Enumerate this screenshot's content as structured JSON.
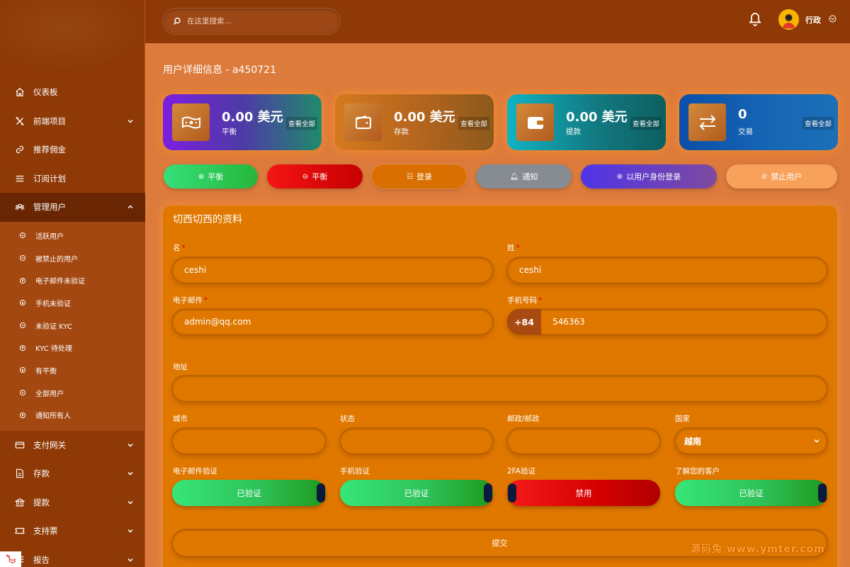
{
  "search": {
    "placeholder": "在这里搜索..."
  },
  "user": {
    "name": "行政"
  },
  "sidebar": {
    "items": [
      {
        "label": "仪表板"
      },
      {
        "label": "前端项目"
      },
      {
        "label": "推荐佣金"
      },
      {
        "label": "订阅计划"
      },
      {
        "label": "管理用户"
      },
      {
        "label": "支付网关"
      },
      {
        "label": "存款"
      },
      {
        "label": "提款"
      },
      {
        "label": "支持票"
      },
      {
        "label": "报告"
      }
    ],
    "subitems": [
      {
        "label": "活跃用户"
      },
      {
        "label": "被禁止的用户"
      },
      {
        "label": "电子邮件未验证"
      },
      {
        "label": "手机未验证"
      },
      {
        "label": "未验证 KYC"
      },
      {
        "label": "KYC 待处理"
      },
      {
        "label": "有平衡"
      },
      {
        "label": "全部用户"
      },
      {
        "label": "通知所有人"
      }
    ]
  },
  "page": {
    "title": "用户详细信息 - a450721"
  },
  "stats": [
    {
      "value": "0.00 美元",
      "label": "平衡",
      "link": "查看全部",
      "icon": "money-icon"
    },
    {
      "value": "0.00 美元",
      "label": "存款",
      "link": "查看全部",
      "icon": "wallet-icon"
    },
    {
      "value": "0.00 美元",
      "label": "提款",
      "link": "查看全部",
      "icon": "wallet-icon"
    },
    {
      "value": "0",
      "label": "交易",
      "link": "查看全部",
      "icon": "exchange-icon"
    }
  ],
  "actions": [
    {
      "label": "平衡",
      "icon": "⊕",
      "color": "#2fc84a"
    },
    {
      "label": "平衡",
      "icon": "⊖",
      "color": "#d80000"
    },
    {
      "label": "登录",
      "icon": "☷",
      "color": "#d96f00"
    },
    {
      "label": "通知",
      "icon": "🔔︎",
      "color": "#878b92"
    },
    {
      "label": "以用户身份登录",
      "icon": "⊕",
      "color": "#5b3fd8"
    },
    {
      "label": "禁止用户",
      "icon": "⊘",
      "color": "#f8a15a"
    }
  ],
  "profile": {
    "title": "切西切西的资料",
    "first_name_label": "名",
    "first_name": "ceshi",
    "last_name_label": "姓",
    "last_name": "ceshi",
    "email_label": "电子邮件",
    "email": "admin@qq.com",
    "phone_label": "手机号码",
    "phone_prefix": "+84",
    "phone": "546363",
    "required_mark": "*",
    "address_label": "地址",
    "address": "",
    "city_label": "城市",
    "state_label": "状态",
    "zip_label": "邮政/邮政",
    "country_label": "国家",
    "country": "越南",
    "email_verify_label": "电子邮件验证",
    "email_verify": "已验证",
    "mobile_verify_label": "手机验证",
    "mobile_verify": "已验证",
    "twofa_label": "2FA验证",
    "twofa": "禁用",
    "kyc_label": "了解您的客户",
    "kyc": "已验证",
    "submit": "提交"
  },
  "watermark": "源码兔 www.ymter.com"
}
